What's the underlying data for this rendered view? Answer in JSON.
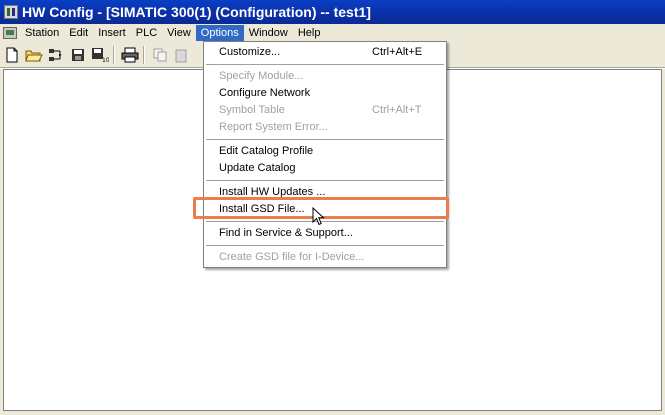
{
  "window": {
    "title": "HW Config - [SIMATIC 300(1) (Configuration) -- test1]"
  },
  "menubar": {
    "items": [
      "Station",
      "Edit",
      "Insert",
      "PLC",
      "View",
      "Options",
      "Window",
      "Help"
    ],
    "active": "Options"
  },
  "toolbar": {
    "icons": [
      "new-icon",
      "open-icon",
      "network-icon",
      "save-icon",
      "save-compile-icon",
      "print-icon",
      "copy-icon",
      "paste-icon"
    ]
  },
  "options_menu": {
    "items": [
      {
        "label": "Customize...",
        "shortcut": "Ctrl+Alt+E",
        "enabled": true
      },
      {
        "label": "Specify Module...",
        "shortcut": "",
        "enabled": false
      },
      {
        "label": "Configure Network",
        "shortcut": "",
        "enabled": true
      },
      {
        "label": "Symbol Table",
        "shortcut": "Ctrl+Alt+T",
        "enabled": false
      },
      {
        "label": "Report System Error...",
        "shortcut": "",
        "enabled": false
      },
      {
        "label": "Edit Catalog Profile",
        "shortcut": "",
        "enabled": true
      },
      {
        "label": "Update Catalog",
        "shortcut": "",
        "enabled": true
      },
      {
        "label": "Install HW Updates ...",
        "shortcut": "",
        "enabled": true
      },
      {
        "label": "Install GSD File...",
        "shortcut": "",
        "enabled": true
      },
      {
        "label": "Find in Service & Support...",
        "shortcut": "",
        "enabled": true
      },
      {
        "label": "Create GSD file for I-Device...",
        "shortcut": "",
        "enabled": false
      }
    ],
    "highlighted": "Install GSD File...",
    "highlight_color": "#ee7d4c"
  },
  "colors": {
    "titlebar": "#0b2fa6",
    "menu_active": "#316ac5",
    "chrome": "#ece9d8"
  }
}
